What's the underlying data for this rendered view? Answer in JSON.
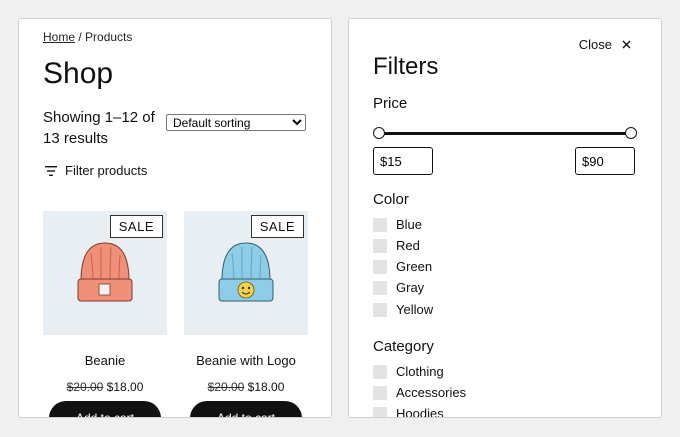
{
  "breadcrumb": {
    "home": "Home",
    "separator": " / ",
    "current": "Products"
  },
  "shop": {
    "title": "Shop",
    "results": "Showing 1–12 of 13 results",
    "sorting": {
      "selected": "Default sorting"
    },
    "filter_toggle": "Filter products"
  },
  "products": [
    {
      "name": "Beanie",
      "badge": "SALE",
      "old_price": "$20.00",
      "price": "$18.00",
      "button": "Add to cart",
      "color": "#f0907a"
    },
    {
      "name": "Beanie with Logo",
      "badge": "SALE",
      "old_price": "$20.00",
      "price": "$18.00",
      "button": "Add to cart",
      "color": "#8fcde6"
    }
  ],
  "filters": {
    "close": "Close",
    "title": "Filters",
    "price": {
      "label": "Price",
      "min": "$15",
      "max": "$90"
    },
    "color": {
      "label": "Color",
      "options": [
        "Blue",
        "Red",
        "Green",
        "Gray",
        "Yellow"
      ]
    },
    "category": {
      "label": "Category",
      "options": [
        "Clothing",
        "Accessories",
        "Hoodies"
      ]
    }
  }
}
